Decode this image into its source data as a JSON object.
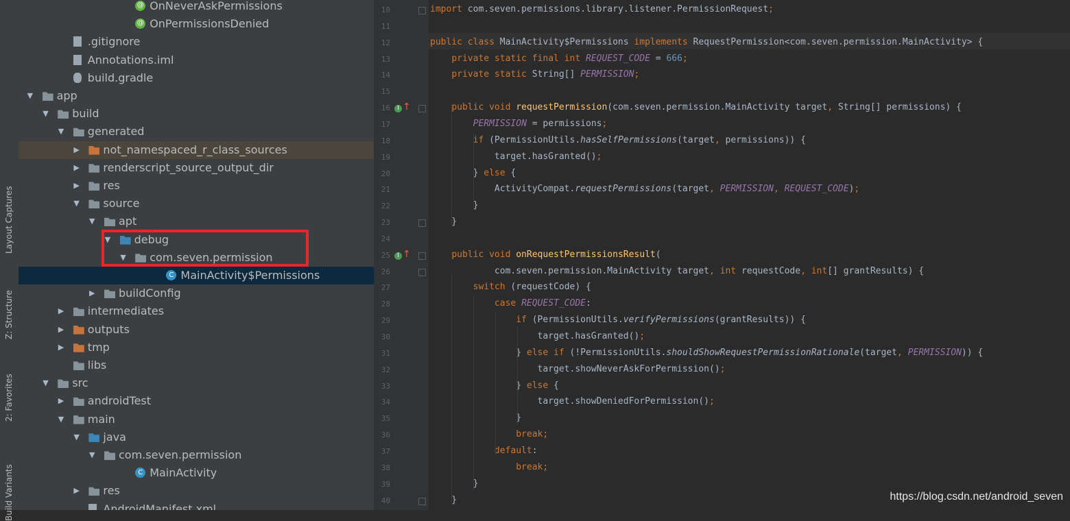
{
  "side_tabs": [
    {
      "label": "Layout Captures"
    },
    {
      "label": "Z: Structure"
    },
    {
      "label": "2: Favorites"
    },
    {
      "label": "Build Variants"
    }
  ],
  "tree": [
    {
      "label": "OnNeverAskPermissions",
      "icon": "annotation-icon",
      "depth": 7,
      "arrow": ""
    },
    {
      "label": "OnPermissionsDenied",
      "icon": "annotation-icon",
      "depth": 7,
      "arrow": ""
    },
    {
      "label": ".gitignore",
      "icon": "file-icon",
      "depth": 3,
      "arrow": ""
    },
    {
      "label": "Annotations.iml",
      "icon": "module-file-icon",
      "depth": 3,
      "arrow": ""
    },
    {
      "label": "build.gradle",
      "icon": "gradle-icon",
      "depth": 3,
      "arrow": ""
    },
    {
      "label": "app",
      "icon": "module-folder-icon",
      "depth": 1,
      "arrow": "▼"
    },
    {
      "label": "build",
      "icon": "folder-icon",
      "depth": 2,
      "arrow": "▼"
    },
    {
      "label": "generated",
      "icon": "folder-icon",
      "depth": 3,
      "arrow": "▼"
    },
    {
      "label": "not_namespaced_r_class_sources",
      "icon": "orange-folder-icon",
      "depth": 4,
      "arrow": "▶"
    },
    {
      "label": "renderscript_source_output_dir",
      "icon": "folder-icon",
      "depth": 4,
      "arrow": "▶"
    },
    {
      "label": "res",
      "icon": "folder-icon",
      "depth": 4,
      "arrow": "▶"
    },
    {
      "label": "source",
      "icon": "folder-icon",
      "depth": 4,
      "arrow": "▼"
    },
    {
      "label": "apt",
      "icon": "folder-icon",
      "depth": 5,
      "arrow": "▼"
    },
    {
      "label": "debug",
      "icon": "generated-source-folder-icon",
      "depth": 6,
      "arrow": "▼"
    },
    {
      "label": "com.seven.permission",
      "icon": "package-icon",
      "depth": 7,
      "arrow": "▼"
    },
    {
      "label": "MainActivity$Permissions",
      "icon": "class-icon",
      "depth": 9,
      "arrow": ""
    },
    {
      "label": "buildConfig",
      "icon": "folder-icon",
      "depth": 5,
      "arrow": "▶"
    },
    {
      "label": "intermediates",
      "icon": "folder-icon",
      "depth": 3,
      "arrow": "▶"
    },
    {
      "label": "outputs",
      "icon": "orange-folder-icon",
      "depth": 3,
      "arrow": "▶"
    },
    {
      "label": "tmp",
      "icon": "orange-folder-icon",
      "depth": 3,
      "arrow": "▶"
    },
    {
      "label": "libs",
      "icon": "folder-icon",
      "depth": 3,
      "arrow": ""
    },
    {
      "label": "src",
      "icon": "folder-icon",
      "depth": 2,
      "arrow": "▼"
    },
    {
      "label": "androidTest",
      "icon": "folder-icon",
      "depth": 3,
      "arrow": "▶"
    },
    {
      "label": "main",
      "icon": "folder-icon",
      "depth": 3,
      "arrow": "▼"
    },
    {
      "label": "java",
      "icon": "source-folder-icon",
      "depth": 4,
      "arrow": "▼"
    },
    {
      "label": "com.seven.permission",
      "icon": "package-icon",
      "depth": 5,
      "arrow": "▼"
    },
    {
      "label": "MainActivity",
      "icon": "class-icon",
      "depth": 7,
      "arrow": ""
    },
    {
      "label": "res",
      "icon": "resource-folder-icon",
      "depth": 4,
      "arrow": "▶"
    },
    {
      "label": "AndroidManifest.xml",
      "icon": "manifest-icon",
      "depth": 4,
      "arrow": ""
    }
  ],
  "selected_index": 15,
  "highlight_index": 8,
  "editor": {
    "lines": [
      {
        "n": "10",
        "segs": [
          [
            "kw",
            "import "
          ],
          [
            "",
            "com.seven.permissions.library.listener.PermissionRequest"
          ],
          [
            "kw",
            ";"
          ]
        ]
      },
      {
        "n": "11",
        "segs": []
      },
      {
        "n": "12",
        "segs": [
          [
            "kw",
            "public class "
          ],
          [
            "",
            "MainActivity$Permissions "
          ],
          [
            "kw",
            "implements "
          ],
          [
            "",
            "RequestPermission<com.seven.permission.MainActivity> {"
          ]
        ]
      },
      {
        "n": "13",
        "segs": [
          [
            "",
            "    "
          ],
          [
            "kw",
            "private static final int "
          ],
          [
            "cn",
            "REQUEST_CODE"
          ],
          [
            "",
            " = "
          ],
          [
            "num",
            "666"
          ],
          [
            "kw",
            ";"
          ]
        ]
      },
      {
        "n": "14",
        "segs": [
          [
            "",
            "    "
          ],
          [
            "kw",
            "private static "
          ],
          [
            "",
            "String[] "
          ],
          [
            "cn",
            "PERMISSION"
          ],
          [
            "kw",
            ";"
          ]
        ]
      },
      {
        "n": "15",
        "segs": []
      },
      {
        "n": "16",
        "segs": [
          [
            "",
            "    "
          ],
          [
            "kw",
            "public void "
          ],
          [
            "fn",
            "requestPermission"
          ],
          [
            "",
            "(com.seven.permission.MainActivity target"
          ],
          [
            "kw",
            ", "
          ],
          [
            "",
            "String[] permissions) {"
          ]
        ]
      },
      {
        "n": "17",
        "segs": [
          [
            "",
            "        "
          ],
          [
            "cn",
            "PERMISSION"
          ],
          [
            "",
            " = permissions"
          ],
          [
            "kw",
            ";"
          ]
        ]
      },
      {
        "n": "18",
        "segs": [
          [
            "",
            "        "
          ],
          [
            "kw",
            "if "
          ],
          [
            "",
            "(PermissionUtils."
          ],
          [
            "st",
            "hasSelfPermissions"
          ],
          [
            "",
            "(target"
          ],
          [
            "kw",
            ", "
          ],
          [
            "",
            "permissions)) {"
          ]
        ]
      },
      {
        "n": "19",
        "segs": [
          [
            "",
            "            target.hasGranted()"
          ],
          [
            "kw",
            ";"
          ]
        ]
      },
      {
        "n": "20",
        "segs": [
          [
            "",
            "        } "
          ],
          [
            "kw",
            "else "
          ],
          [
            "",
            "{"
          ]
        ]
      },
      {
        "n": "21",
        "segs": [
          [
            "",
            "            ActivityCompat."
          ],
          [
            "st",
            "requestPermissions"
          ],
          [
            "",
            "(target"
          ],
          [
            "kw",
            ", "
          ],
          [
            "cn",
            "PERMISSION"
          ],
          [
            "kw",
            ", "
          ],
          [
            "cn",
            "REQUEST_CODE"
          ],
          [
            "",
            ")"
          ],
          [
            "kw",
            ";"
          ]
        ]
      },
      {
        "n": "22",
        "segs": [
          [
            "",
            "        }"
          ]
        ]
      },
      {
        "n": "23",
        "segs": [
          [
            "",
            "    }"
          ]
        ]
      },
      {
        "n": "24",
        "segs": []
      },
      {
        "n": "25",
        "segs": [
          [
            "",
            "    "
          ],
          [
            "kw",
            "public void "
          ],
          [
            "fn",
            "onRequestPermissionsResult"
          ],
          [
            "",
            "("
          ]
        ]
      },
      {
        "n": "26",
        "segs": [
          [
            "",
            "            com.seven.permission.MainActivity target"
          ],
          [
            "kw",
            ", int "
          ],
          [
            "",
            "requestCode"
          ],
          [
            "kw",
            ", int"
          ],
          [
            "",
            "[] grantResults) {"
          ]
        ]
      },
      {
        "n": "27",
        "segs": [
          [
            "",
            "        "
          ],
          [
            "kw",
            "switch "
          ],
          [
            "",
            "(requestCode) {"
          ]
        ]
      },
      {
        "n": "28",
        "segs": [
          [
            "",
            "            "
          ],
          [
            "kw",
            "case "
          ],
          [
            "cn",
            "REQUEST_CODE"
          ],
          [
            "",
            ":"
          ]
        ]
      },
      {
        "n": "29",
        "segs": [
          [
            "",
            "                "
          ],
          [
            "kw",
            "if "
          ],
          [
            "",
            "(PermissionUtils."
          ],
          [
            "st",
            "verifyPermissions"
          ],
          [
            "",
            "(grantResults)) {"
          ]
        ]
      },
      {
        "n": "30",
        "segs": [
          [
            "",
            "                    target.hasGranted()"
          ],
          [
            "kw",
            ";"
          ]
        ]
      },
      {
        "n": "31",
        "segs": [
          [
            "",
            "                } "
          ],
          [
            "kw",
            "else if "
          ],
          [
            "",
            "(!PermissionUtils."
          ],
          [
            "st",
            "shouldShowRequestPermissionRationale"
          ],
          [
            "",
            "(target"
          ],
          [
            "kw",
            ", "
          ],
          [
            "cn",
            "PERMISSION"
          ],
          [
            "",
            ")) {"
          ]
        ]
      },
      {
        "n": "32",
        "segs": [
          [
            "",
            "                    target.showNeverAskForPermission()"
          ],
          [
            "kw",
            ";"
          ]
        ]
      },
      {
        "n": "33",
        "segs": [
          [
            "",
            "                } "
          ],
          [
            "kw",
            "else "
          ],
          [
            "",
            "{"
          ]
        ]
      },
      {
        "n": "34",
        "segs": [
          [
            "",
            "                    target.showDeniedForPermission()"
          ],
          [
            "kw",
            ";"
          ]
        ]
      },
      {
        "n": "35",
        "segs": [
          [
            "",
            "                }"
          ]
        ]
      },
      {
        "n": "36",
        "segs": [
          [
            "",
            "                "
          ],
          [
            "kw",
            "break;"
          ]
        ]
      },
      {
        "n": "37",
        "segs": [
          [
            "",
            "            "
          ],
          [
            "kw",
            "default"
          ],
          [
            "",
            ":"
          ]
        ]
      },
      {
        "n": "38",
        "segs": [
          [
            "",
            "                "
          ],
          [
            "kw",
            "break;"
          ]
        ]
      },
      {
        "n": "39",
        "segs": [
          [
            "",
            "        }"
          ]
        ]
      },
      {
        "n": "40",
        "segs": [
          [
            "",
            "    }"
          ]
        ]
      }
    ],
    "implement_markers": [
      "16",
      "25"
    ],
    "fold_markers": [
      "10",
      "16",
      "23",
      "25",
      "26",
      "40"
    ]
  },
  "watermark": "https://blog.csdn.net/android_seven"
}
